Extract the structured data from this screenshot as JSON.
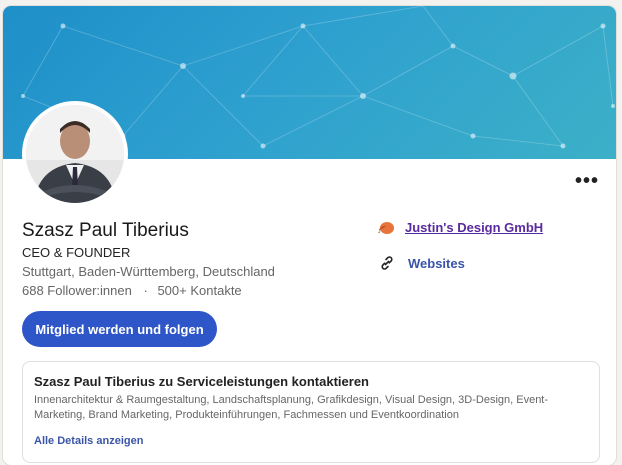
{
  "profile": {
    "name": "Szasz Paul Tiberius",
    "headline": "CEO & FOUNDER",
    "location": "Stuttgart, Baden-Württemberg, Deutschland",
    "followers": "688 Follower:innen",
    "separator": "·",
    "connections": "500+ Kontakte"
  },
  "company": {
    "name": "Justin's Design GmbH",
    "logo_icon": "company-logo-icon"
  },
  "websites": {
    "label": "Websites",
    "icon": "link-icon"
  },
  "actions": {
    "primary_label": "Mitglied werden und folgen",
    "more_label": "•••"
  },
  "services": {
    "title": "Szasz Paul Tiberius zu Serviceleistungen kontaktieren",
    "description": "Innenarchitektur & Raumgestaltung, Landschaftsplanung, Grafikdesign, Visual Design, 3D-Design, Event-Marketing, Brand Marketing, Produkteinführungen, Fachmessen und Eventkoordination",
    "details_link": "Alle Details anzeigen"
  },
  "colors": {
    "primary_button": "#2f56c9",
    "link": "#3a55a8",
    "company_link": "#5b2b9e",
    "banner_start": "#1e8fc8",
    "banner_end": "#3cb0c8"
  }
}
